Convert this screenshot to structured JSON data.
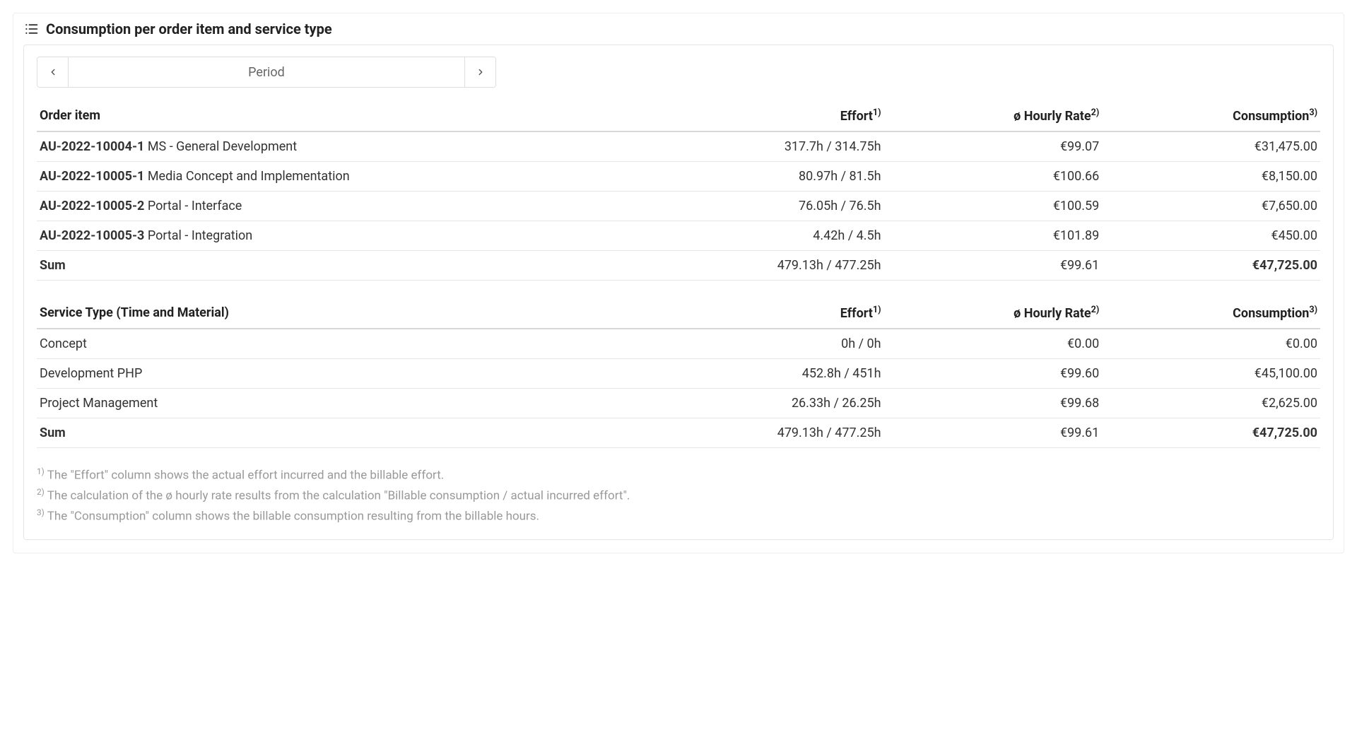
{
  "title": "Consumption per order item and service type",
  "period": {
    "label": "Period"
  },
  "orderTable": {
    "headers": {
      "item": "Order item",
      "effort": "Effort",
      "rate": "ø Hourly Rate",
      "consumption": "Consumption"
    },
    "rows": [
      {
        "code": "AU-2022-10004-1",
        "desc": " MS - General Development",
        "effort": "317.7h / 314.75h",
        "rate": "€99.07",
        "consumption": "€31,475.00"
      },
      {
        "code": "AU-2022-10005-1",
        "desc": " Media Concept and Implementation",
        "effort": "80.97h / 81.5h",
        "rate": "€100.66",
        "consumption": "€8,150.00"
      },
      {
        "code": "AU-2022-10005-2",
        "desc": " Portal - Interface",
        "effort": "76.05h / 76.5h",
        "rate": "€100.59",
        "consumption": "€7,650.00"
      },
      {
        "code": "AU-2022-10005-3",
        "desc": " Portal - Integration",
        "effort": "4.42h / 4.5h",
        "rate": "€101.89",
        "consumption": "€450.00"
      }
    ],
    "sum": {
      "label": "Sum",
      "effort": "479.13h / 477.25h",
      "rate": "€99.61",
      "consumption": "€47,725.00"
    }
  },
  "serviceTable": {
    "headers": {
      "item": "Service Type (Time and Material)",
      "effort": "Effort",
      "rate": "ø Hourly Rate",
      "consumption": "Consumption"
    },
    "rows": [
      {
        "desc": "Concept",
        "effort": "0h / 0h",
        "rate": "€0.00",
        "consumption": "€0.00"
      },
      {
        "desc": "Development PHP",
        "effort": "452.8h / 451h",
        "rate": "€99.60",
        "consumption": "€45,100.00"
      },
      {
        "desc": "Project Management",
        "effort": "26.33h / 26.25h",
        "rate": "€99.68",
        "consumption": "€2,625.00"
      }
    ],
    "sum": {
      "label": "Sum",
      "effort": "479.13h / 477.25h",
      "rate": "€99.61",
      "consumption": "€47,725.00"
    }
  },
  "footnotes": {
    "f1": " The \"Effort\" column shows the actual effort incurred and the billable effort.",
    "f2": " The calculation of the ø hourly rate results from the calculation \"Billable consumption / actual incurred effort\".",
    "f3": " The \"Consumption\" column shows the billable consumption resulting from the billable hours."
  },
  "sup": {
    "s1": "1)",
    "s2": "2)",
    "s3": "3)"
  }
}
